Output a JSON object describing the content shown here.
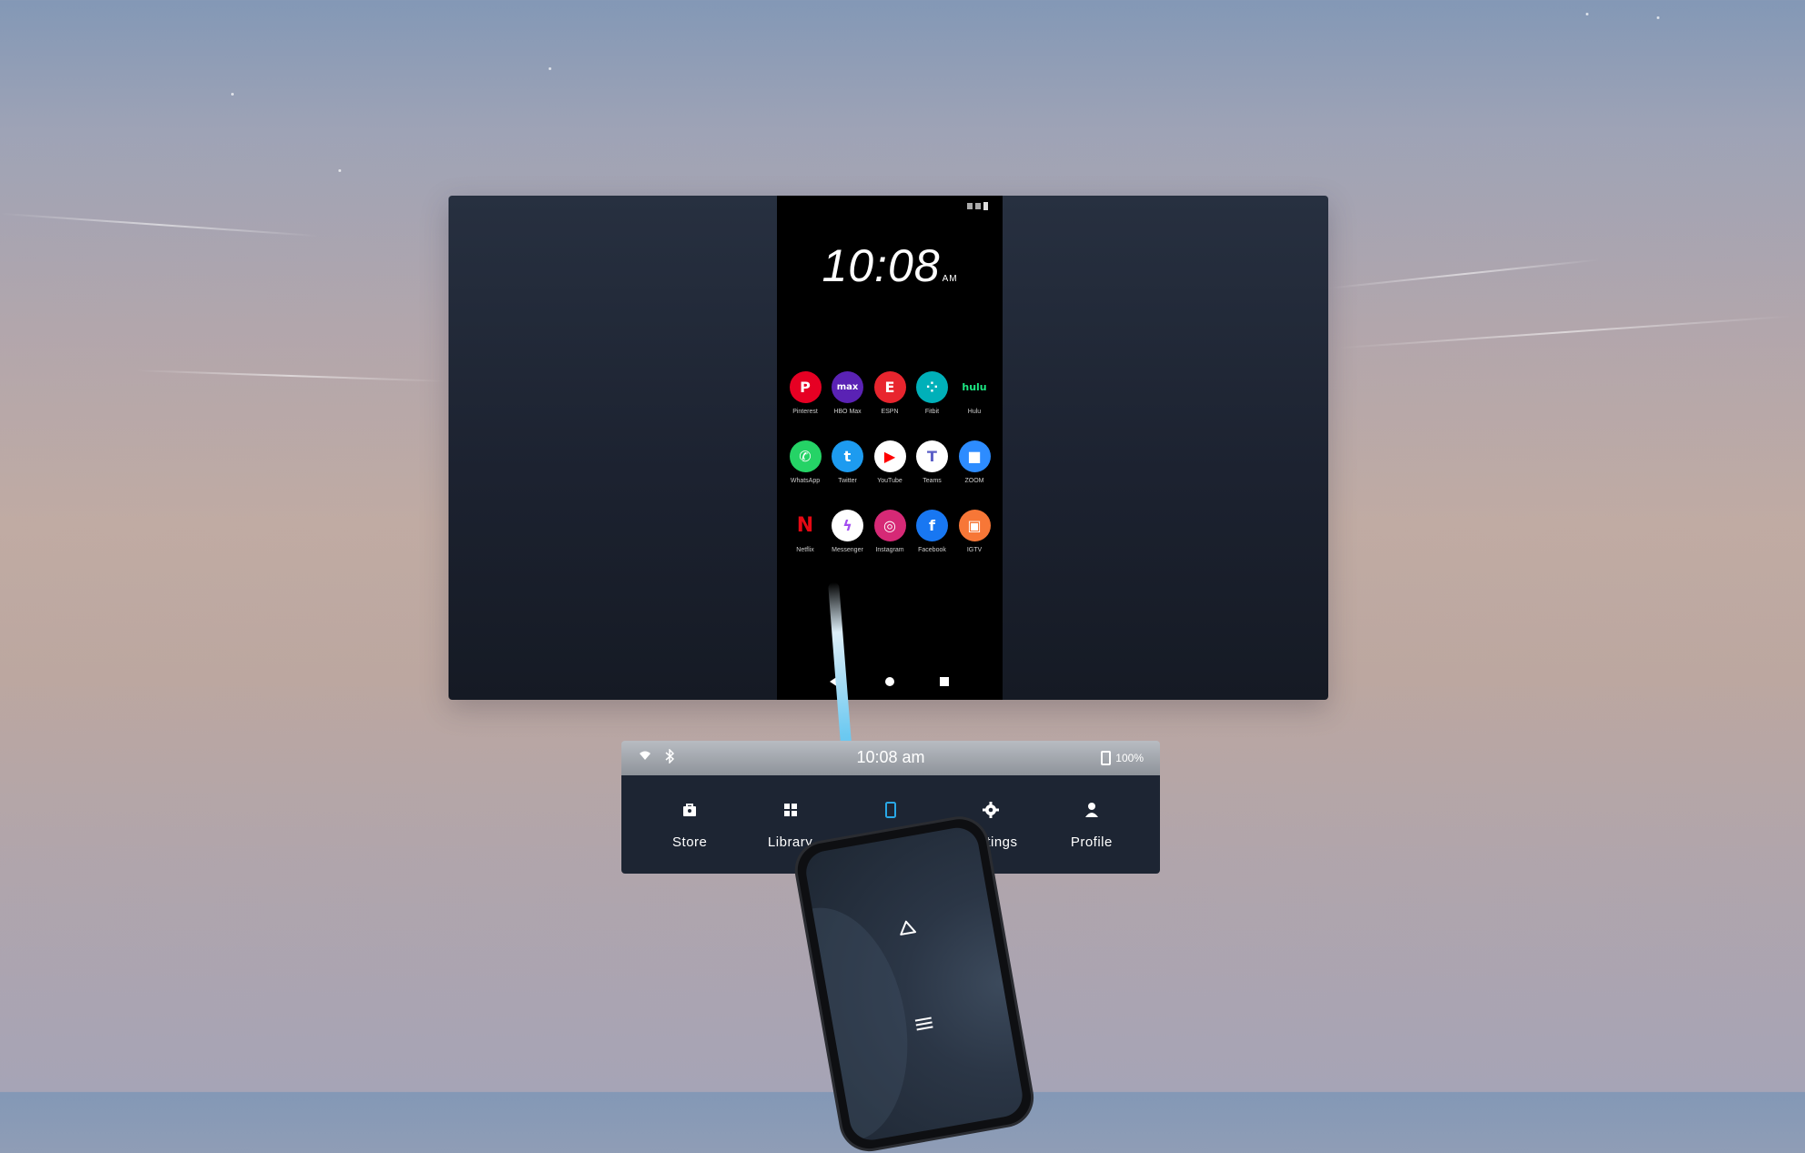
{
  "phone_mirror": {
    "clock": "10:08",
    "clock_ampm": "AM",
    "apps": [
      [
        {
          "label": "Pinterest",
          "icon": "pinterest-icon",
          "bg": "#e60023",
          "glyph": "P"
        },
        {
          "label": "HBO Max",
          "icon": "hbo-max-icon",
          "bg": "#5a22b4",
          "glyph": "max"
        },
        {
          "label": "ESPN",
          "icon": "espn-icon",
          "bg": "#e8252e",
          "glyph": "E"
        },
        {
          "label": "Fitbit",
          "icon": "fitbit-icon",
          "bg": "#00b0b9",
          "glyph": "⁘"
        },
        {
          "label": "Hulu",
          "icon": "hulu-icon",
          "bg": "#000000",
          "glyph": "hulu"
        }
      ],
      [
        {
          "label": "WhatsApp",
          "icon": "whatsapp-icon",
          "bg": "#25d366",
          "glyph": "✆"
        },
        {
          "label": "Twitter",
          "icon": "twitter-icon",
          "bg": "#1d9bf0",
          "glyph": "t"
        },
        {
          "label": "YouTube",
          "icon": "youtube-icon",
          "bg": "#ffffff",
          "glyph": "▶"
        },
        {
          "label": "Teams",
          "icon": "teams-icon",
          "bg": "#ffffff",
          "glyph": "T"
        },
        {
          "label": "ZOOM",
          "icon": "zoom-icon",
          "bg": "#2d8cff",
          "glyph": "■"
        }
      ],
      [
        {
          "label": "Netflix",
          "icon": "netflix-icon",
          "bg": "#000000",
          "glyph": "N"
        },
        {
          "label": "Messenger",
          "icon": "messenger-icon",
          "bg": "#ffffff",
          "glyph": "ϟ"
        },
        {
          "label": "Instagram",
          "icon": "instagram-icon",
          "bg": "#d62976",
          "glyph": "◎"
        },
        {
          "label": "Facebook",
          "icon": "facebook-icon",
          "bg": "#1877f2",
          "glyph": "f"
        },
        {
          "label": "IGTV",
          "icon": "igtv-icon",
          "bg": "#f77737",
          "glyph": "▣"
        }
      ]
    ]
  },
  "dock": {
    "time": "10:08 am",
    "battery": "100%",
    "active_color": "#29a8e6",
    "tabs": [
      {
        "label": "Store",
        "icon": "store-icon"
      },
      {
        "label": "Library",
        "icon": "library-icon"
      },
      {
        "label": "Phone",
        "icon": "phone-icon",
        "active": true
      },
      {
        "label": "Settings",
        "icon": "gear-icon"
      },
      {
        "label": "Profile",
        "icon": "profile-icon"
      }
    ]
  }
}
